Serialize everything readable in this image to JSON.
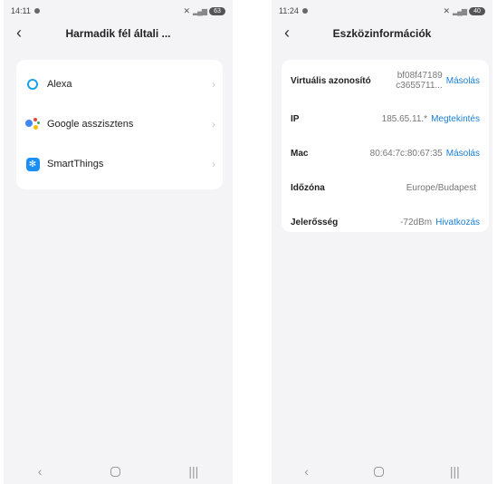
{
  "left": {
    "status": {
      "time": "14:11",
      "battery": "63"
    },
    "title": "Harmadik fél általi ...",
    "services": [
      {
        "label": "Alexa",
        "icon": "alexa-icon"
      },
      {
        "label": "Google asszisztens",
        "icon": "google-assistant-icon"
      },
      {
        "label": "SmartThings",
        "icon": "smartthings-icon"
      }
    ]
  },
  "right": {
    "status": {
      "time": "11:24",
      "battery": "40"
    },
    "title": "Eszközinformációk",
    "rows": [
      {
        "key": "Virtuális azonosító",
        "value_line1": "bf08f47189",
        "value_line2": "c3655711...",
        "action": "Másolás"
      },
      {
        "key": "IP",
        "value": "185.65.11.*",
        "action": "Megtekintés"
      },
      {
        "key": "Mac",
        "value": "80:64:7c:80:67:35",
        "action": "Másolás"
      },
      {
        "key": "Időzóna",
        "value": "Europe/Budapest"
      },
      {
        "key": "Jelerősség",
        "value": "-72dBm",
        "action": "Hivatkozás"
      }
    ]
  },
  "colors": {
    "accent": "#1a7fd6",
    "background": "#f4f4f6",
    "alexa": "#1aa3e6",
    "smartthings": "#1a8ff5",
    "google_blue": "#4285f4",
    "google_red": "#ea4335",
    "google_yellow": "#fbbc05",
    "google_green": "#34a853"
  }
}
